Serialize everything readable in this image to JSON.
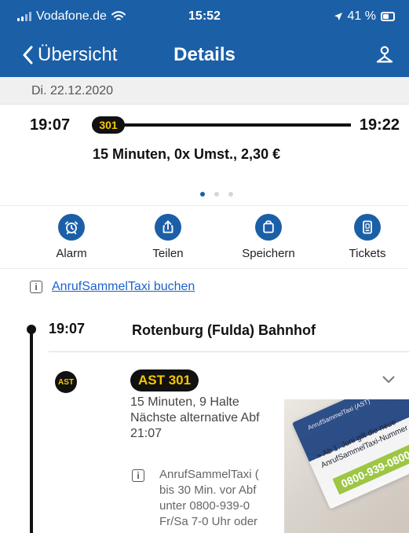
{
  "status_bar": {
    "carrier": "Vodafone.de",
    "time": "15:52",
    "battery_percent": "41 %"
  },
  "navbar": {
    "back_label": "Übersicht",
    "title": "Details"
  },
  "date": "Di. 22.12.2020",
  "trip": {
    "departure_time": "19:07",
    "arrival_time": "19:22",
    "line_badge": "301",
    "summary": "15 Minuten,  0x Umst.,  2,30 €",
    "pager_active_index": 0,
    "pager_count": 3
  },
  "actions": [
    {
      "label": "Alarm",
      "icon": "alarm-clock-icon"
    },
    {
      "label": "Teilen",
      "icon": "share-icon"
    },
    {
      "label": "Speichern",
      "icon": "bag-icon"
    },
    {
      "label": "Tickets",
      "icon": "ticket-phone-icon"
    }
  ],
  "link": {
    "icon": "info-icon",
    "text": "AnrufSammelTaxi buchen"
  },
  "timeline": {
    "stop_time": "19:07",
    "stop_name": "Rotenburg (Fulda) Bahnhof",
    "service_short": "AST",
    "service_label": "AST 301",
    "detail_lines": [
      "15 Minuten, 9 Halte",
      "Nächste alternative Abf",
      "21:07"
    ],
    "note_lines": [
      "AnrufSammelTaxi (",
      "bis 30 Min. vor Abf",
      "unter 0800-939-0",
      "Fr/Sa 7-0 Uhr oder"
    ]
  },
  "photo": {
    "flyer_header": "AnrufSammelTaxi (AST)",
    "line_a": "» Ab 1. Juni gilt die neue",
    "line_b": "AnrufSammelTaxi-Nummer",
    "number": "0800-939-0800"
  },
  "colors": {
    "primary": "#1b5fa7",
    "badge_text": "#f6c700",
    "link": "#1d62cc"
  }
}
